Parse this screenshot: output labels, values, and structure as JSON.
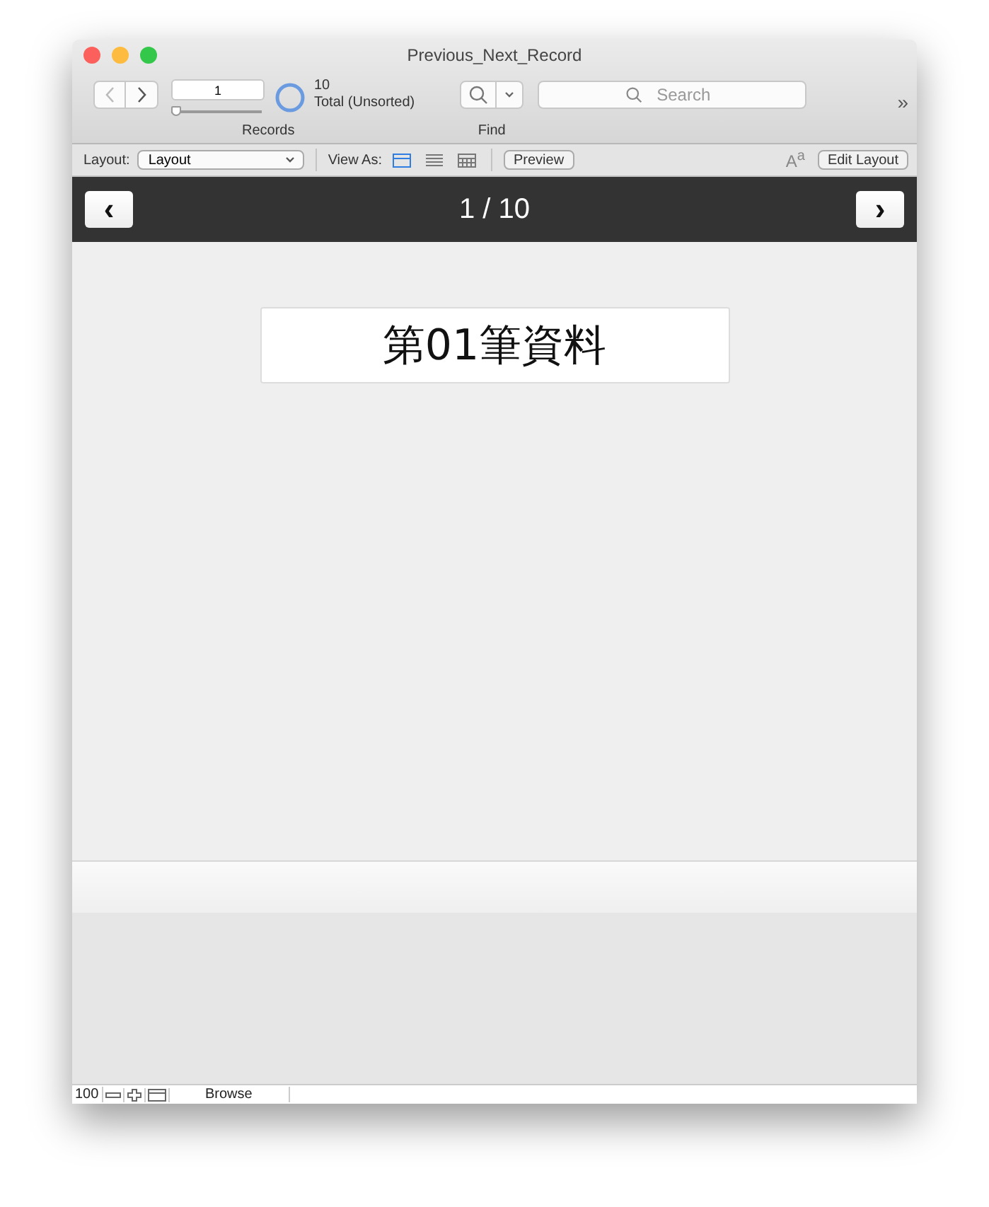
{
  "window": {
    "title": "Previous_Next_Record"
  },
  "toolbar": {
    "record_number": "1",
    "slider": {
      "level": 0
    },
    "found_count": "10",
    "total_label": "Total (Unsorted)",
    "records_label": "Records",
    "find_label": "Find",
    "search": {
      "placeholder": "Search"
    },
    "overflow": "»"
  },
  "layout_bar": {
    "layout_label": "Layout:",
    "layout_value": "Layout",
    "view_as_label": "View As:",
    "view_modes": [
      {
        "kind": "form",
        "selected": true
      },
      {
        "kind": "list",
        "selected": false
      },
      {
        "kind": "table",
        "selected": false
      }
    ],
    "preview_button": "Preview",
    "format_text": "A$^{a}$",
    "edit_layout_button": "Edit Layout"
  },
  "header": {
    "prev": "‹",
    "counter": "1 / 10",
    "next": "›"
  },
  "record": {
    "field_value": "第01筆資料"
  },
  "status_bar": {
    "zoom": "100",
    "mode": "Browse"
  }
}
